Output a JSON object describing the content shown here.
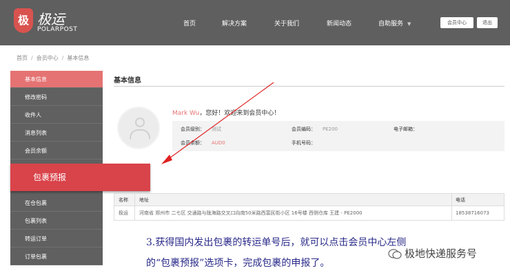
{
  "header": {
    "logo_mark": "极",
    "logo_cn": "极运",
    "logo_en": "POLARPOST",
    "nav": [
      "首页",
      "解决方案",
      "关于我们",
      "新闻动态",
      "自助服务"
    ],
    "member_center": "会员中心",
    "logout": "退出"
  },
  "breadcrumb": [
    "首页",
    "会员中心",
    "基本信息"
  ],
  "sidebar": {
    "items": [
      "基本信息",
      "修改密码",
      "收件人",
      "消息列表",
      "会员余额",
      "",
      "",
      "在仓包裹",
      "包裹列表",
      "转运订单",
      "订单包裹"
    ],
    "active": "基本信息",
    "highlight": "包裹预报"
  },
  "main": {
    "title": "基本信息",
    "welcome_name": "Mark Wu",
    "welcome_text": "，您好！欢迎来到会员中心！",
    "info": {
      "level_label": "会员级别：",
      "level_value": "测试",
      "code_label": "会员编码：",
      "code_value": "PE200",
      "email_label": "电子邮箱：",
      "email_value": "",
      "balance_label": "会员余额：",
      "balance_value": "AUD0",
      "phone_label": "手机号码：",
      "phone_value": ""
    },
    "table": {
      "headers": [
        "名称",
        "地址",
        "电话"
      ],
      "row": {
        "name": "极运",
        "address": "河南省 郑州市 二七区 交通路与陇海路交叉口向南50米路西富民街小区 16号楼 西侧仓库 王建 - PE2000",
        "phone": "18538716073"
      }
    }
  },
  "caption": {
    "line1": "3.获得国内发出包裹的转运单号后，就可以点击会员中心左侧",
    "line2": "的“包裹预报”选项卡，完成包裹的申报了。"
  },
  "watermark": "极地快递服务号",
  "colors": {
    "topbar": "#5f5f5f",
    "sidebar": "#606060",
    "accent": "#e57373",
    "popout": "#d9434a",
    "caption": "#2a2a8a"
  }
}
